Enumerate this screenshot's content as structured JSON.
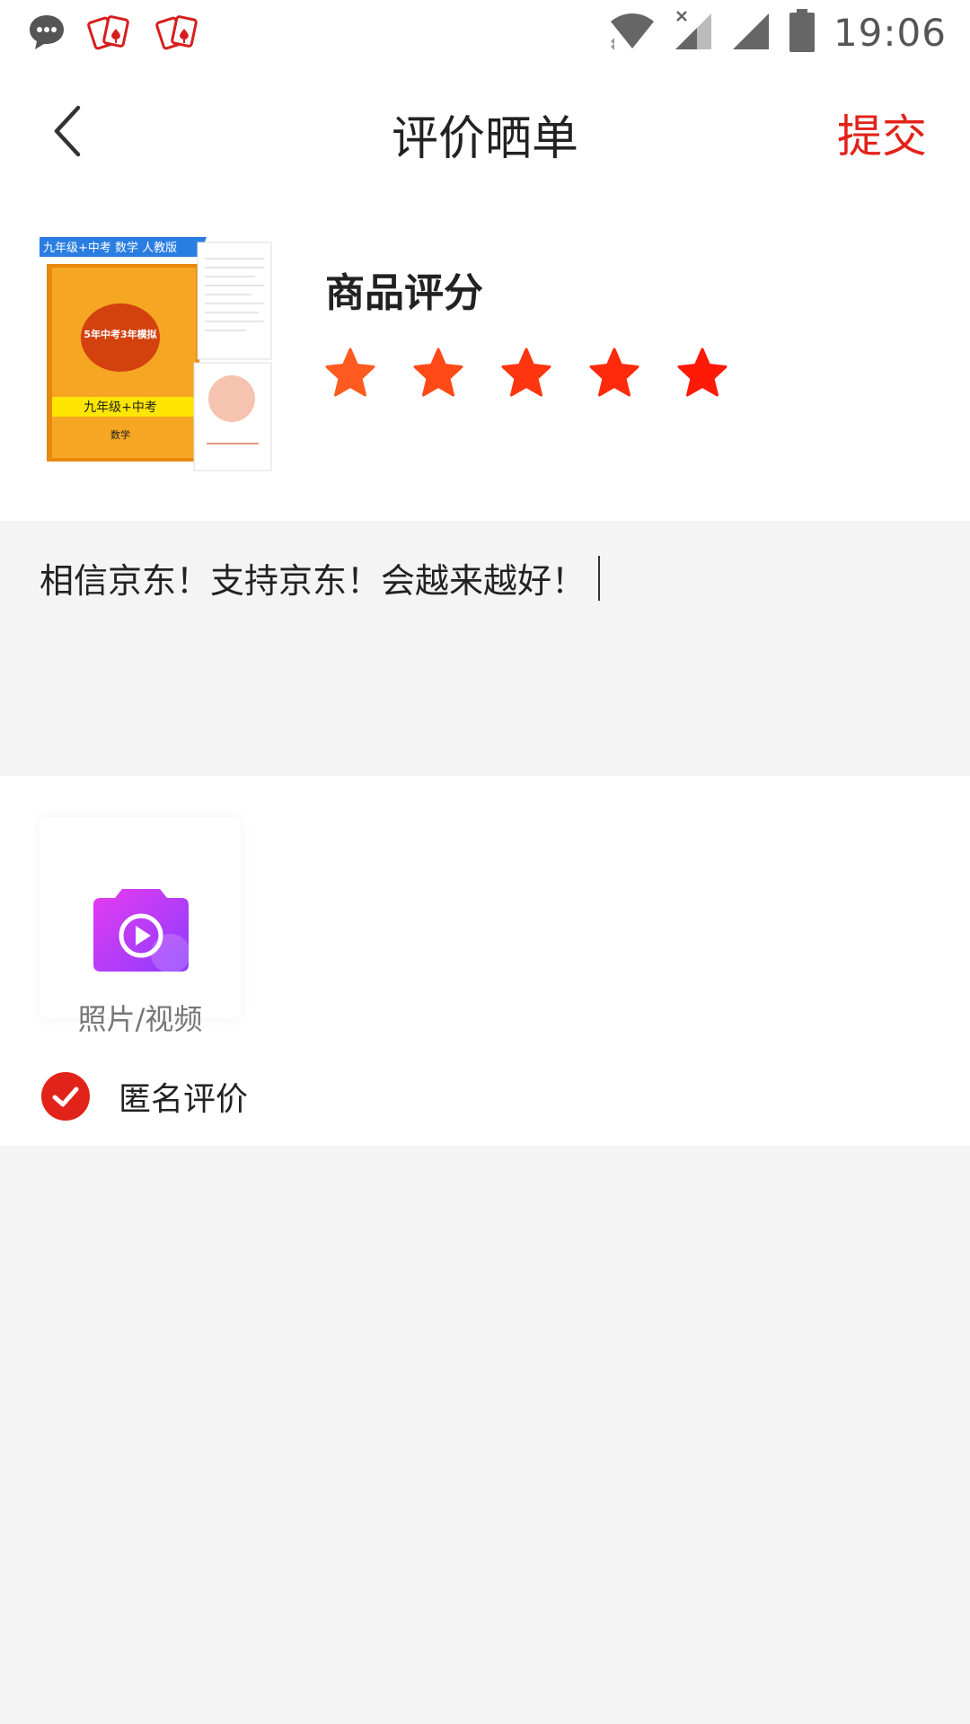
{
  "status_bar": {
    "time": "19:06",
    "icons": [
      "message-icon",
      "poker-app-icon",
      "poker-app-icon",
      "wifi-icon",
      "signal-icon",
      "signal-icon",
      "battery-icon"
    ]
  },
  "header": {
    "title": "评价晒单",
    "submit_label": "提交",
    "back_icon": "chevron-left-icon"
  },
  "product": {
    "cover_texts": {
      "banner": "九年级+中考  数学  人教版",
      "brand": "5年中考3年模拟",
      "grade": "九年级+中考",
      "subject": "数学"
    },
    "rating_title": "商品评分",
    "rating": 5,
    "rating_max": 5,
    "star_colors": [
      "#ff5a1f",
      "#ff4a18",
      "#ff3510",
      "#ff2a0c",
      "#ff1a08"
    ]
  },
  "comment": {
    "text": "相信京东！支持京东！会越来越好！"
  },
  "media": {
    "upload_label": "照片/视频",
    "upload_icon": "camera-video-icon"
  },
  "anonymous": {
    "label": "匿名评价",
    "checked": true,
    "color": "#e2231a"
  },
  "colors": {
    "accent": "#e2231a",
    "background": "#f4f4f4"
  }
}
